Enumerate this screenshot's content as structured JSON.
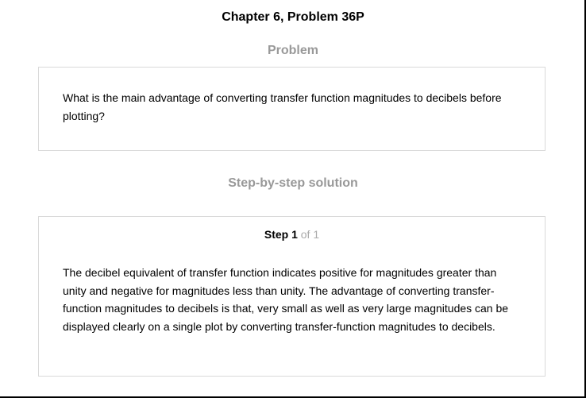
{
  "page": {
    "chapter_title": "Chapter 6, Problem 36P"
  },
  "problem": {
    "heading": "Problem",
    "text": "What is the main advantage of converting transfer function magnitudes to decibels before plotting?"
  },
  "solution": {
    "heading": "Step-by-step solution",
    "step_label": "Step 1",
    "step_total": "of 1",
    "text": "The decibel equivalent of transfer function indicates positive for magnitudes greater than unity and negative for magnitudes less than unity. The advantage of converting transfer-function magnitudes to decibels is that, very small as well as very large magnitudes can be displayed clearly on a single plot by converting transfer-function magnitudes to decibels."
  },
  "colors": {
    "heading_gray": "#999999",
    "step_total_gray": "#aaaaaa",
    "card_border": "#d9d9d9"
  }
}
